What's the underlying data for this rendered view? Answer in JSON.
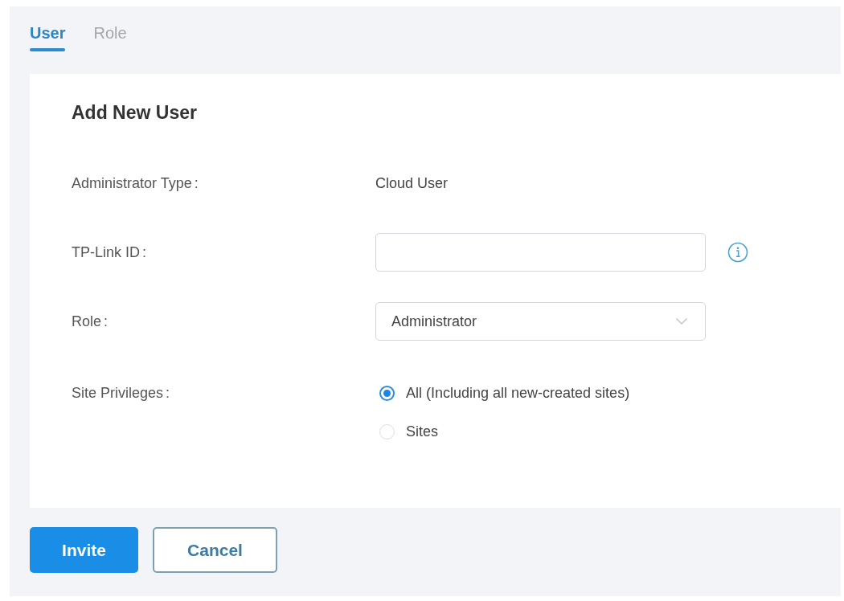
{
  "tabs": [
    {
      "label": "User",
      "selected": true
    },
    {
      "label": "Role",
      "selected": false
    }
  ],
  "form": {
    "title": "Add New User",
    "fields": [
      {
        "kind": "text",
        "label": "Administrator Type",
        "separator": ":",
        "value": "Cloud User"
      },
      {
        "kind": "input",
        "label": "TP-Link ID",
        "separator": ":",
        "info": true
      },
      {
        "kind": "select",
        "label": "Role",
        "separator": ":",
        "value": "Administrator"
      },
      {
        "kind": "radio",
        "label": "Site Privileges",
        "separator": ":",
        "options": [
          {
            "label": "All (Including all new-created sites)",
            "selected": true
          },
          {
            "label": "Sites",
            "selected": false
          }
        ]
      }
    ]
  },
  "buttons": [
    {
      "label": "Invite",
      "kind": "primary"
    },
    {
      "label": "Cancel",
      "kind": "secondary"
    }
  ]
}
